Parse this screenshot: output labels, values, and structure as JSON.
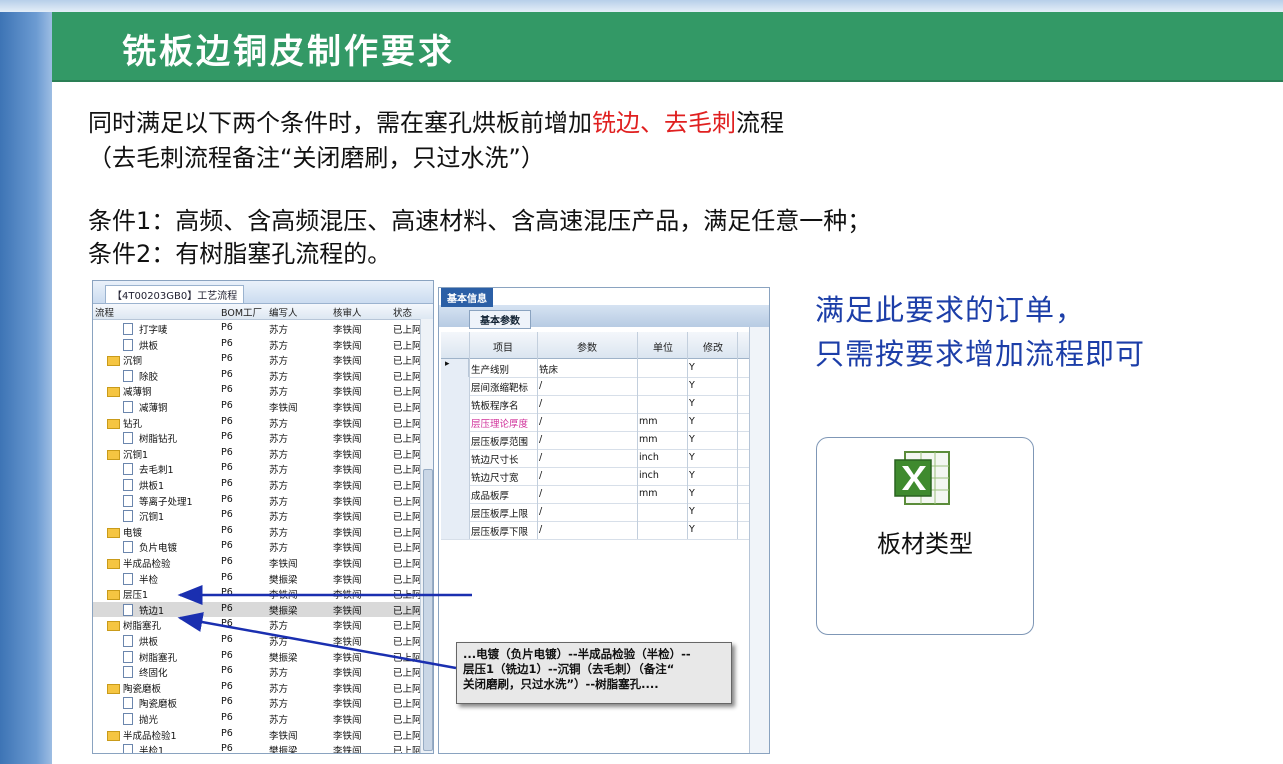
{
  "slide": {
    "title": "铣板边铜皮制作要求",
    "line1_a": "同时满足以下两个条件时，需在塞孔烘板前增加",
    "line1_red": "铣边、去毛刺",
    "line1_b": "流程",
    "line2": "（去毛刺流程备注“关闭磨刷，只过水洗”）",
    "cond1": "条件1：高频、含高频混压、高速材料、含高速混压产品，满足任意一种；",
    "cond2": "条件2：有树脂塞孔流程的。",
    "note_line1": "满足此要求的订单，",
    "note_line2": "只需按要求增加流程即可",
    "excel_label": "板材类型",
    "accent_color": "#339966",
    "note_color": "#1c3ea8"
  },
  "tree_panel": {
    "tab": "【4T00203GB0】工艺流程",
    "headers": [
      "流程",
      "BOM工厂",
      "编写人",
      "核审人",
      "状态"
    ],
    "rows": [
      {
        "name": "打字唛",
        "type": "doc",
        "level": 2,
        "bom": "P6",
        "writer": "苏方",
        "reviewer": "李铁闯",
        "status": "已上阿"
      },
      {
        "name": "烘板",
        "type": "doc",
        "level": 2,
        "bom": "P6",
        "writer": "苏方",
        "reviewer": "李铁闯",
        "status": "已上阿"
      },
      {
        "name": "沉铜",
        "type": "folder",
        "level": 1,
        "bom": "P6",
        "writer": "苏方",
        "reviewer": "李铁闯",
        "status": "已上阿"
      },
      {
        "name": "除胶",
        "type": "doc",
        "level": 2,
        "bom": "P6",
        "writer": "苏方",
        "reviewer": "李铁闯",
        "status": "已上阿"
      },
      {
        "name": "减薄铜",
        "type": "folder",
        "level": 1,
        "bom": "P6",
        "writer": "苏方",
        "reviewer": "李铁闯",
        "status": "已上阿"
      },
      {
        "name": "减薄铜",
        "type": "doc",
        "level": 2,
        "bom": "P6",
        "writer": "李铁闯",
        "reviewer": "李铁闯",
        "status": "已上阿"
      },
      {
        "name": "钻孔",
        "type": "folder",
        "level": 1,
        "bom": "P6",
        "writer": "苏方",
        "reviewer": "李铁闯",
        "status": "已上阿"
      },
      {
        "name": "树脂钻孔",
        "type": "doc",
        "level": 2,
        "bom": "P6",
        "writer": "苏方",
        "reviewer": "李铁闯",
        "status": "已上阿"
      },
      {
        "name": "沉铜1",
        "type": "folder",
        "level": 1,
        "bom": "P6",
        "writer": "苏方",
        "reviewer": "李铁闯",
        "status": "已上阿"
      },
      {
        "name": "去毛刺1",
        "type": "doc",
        "level": 2,
        "bom": "P6",
        "writer": "苏方",
        "reviewer": "李铁闯",
        "status": "已上阿"
      },
      {
        "name": "烘板1",
        "type": "doc",
        "level": 2,
        "bom": "P6",
        "writer": "苏方",
        "reviewer": "李铁闯",
        "status": "已上阿"
      },
      {
        "name": "等离子处理1",
        "type": "doc",
        "level": 2,
        "bom": "P6",
        "writer": "苏方",
        "reviewer": "李铁闯",
        "status": "已上阿"
      },
      {
        "name": "沉铜1",
        "type": "doc",
        "level": 2,
        "bom": "P6",
        "writer": "苏方",
        "reviewer": "李铁闯",
        "status": "已上阿"
      },
      {
        "name": "电镀",
        "type": "folder",
        "level": 1,
        "bom": "P6",
        "writer": "苏方",
        "reviewer": "李铁闯",
        "status": "已上阿"
      },
      {
        "name": "负片电镀",
        "type": "doc",
        "level": 2,
        "bom": "P6",
        "writer": "苏方",
        "reviewer": "李铁闯",
        "status": "已上阿"
      },
      {
        "name": "半成品检验",
        "type": "folder",
        "level": 1,
        "bom": "P6",
        "writer": "李铁闯",
        "reviewer": "李铁闯",
        "status": "已上阿"
      },
      {
        "name": "半检",
        "type": "doc",
        "level": 2,
        "bom": "P6",
        "writer": "樊振梁",
        "reviewer": "李铁闯",
        "status": "已上阿"
      },
      {
        "name": "层压1",
        "type": "folder",
        "level": 1,
        "bom": "P6",
        "writer": "李铁闯",
        "reviewer": "李铁闯",
        "status": "已上阿"
      },
      {
        "name": "铣边1",
        "type": "doc",
        "level": 2,
        "bom": "P6",
        "writer": "樊振梁",
        "reviewer": "李铁闯",
        "status": "已上阿",
        "highlight": true
      },
      {
        "name": "树脂塞孔",
        "type": "folder",
        "level": 1,
        "bom": "P6",
        "writer": "苏方",
        "reviewer": "李铁闯",
        "status": "已上阿"
      },
      {
        "name": "烘板",
        "type": "doc",
        "level": 2,
        "bom": "P6",
        "writer": "苏方",
        "reviewer": "李铁闯",
        "status": "已上阿"
      },
      {
        "name": "树脂塞孔",
        "type": "doc",
        "level": 2,
        "bom": "P6",
        "writer": "樊振梁",
        "reviewer": "李铁闯",
        "status": "已上阿"
      },
      {
        "name": "终固化",
        "type": "doc",
        "level": 2,
        "bom": "P6",
        "writer": "苏方",
        "reviewer": "李铁闯",
        "status": "已上阿"
      },
      {
        "name": "陶瓷磨板",
        "type": "folder",
        "level": 1,
        "bom": "P6",
        "writer": "苏方",
        "reviewer": "李铁闯",
        "status": "已上阿"
      },
      {
        "name": "陶瓷磨板",
        "type": "doc",
        "level": 2,
        "bom": "P6",
        "writer": "苏方",
        "reviewer": "李铁闯",
        "status": "已上阿"
      },
      {
        "name": "抛光",
        "type": "doc",
        "level": 2,
        "bom": "P6",
        "writer": "苏方",
        "reviewer": "李铁闯",
        "status": "已上阿"
      },
      {
        "name": "半成品检验1",
        "type": "folder",
        "level": 1,
        "bom": "P6",
        "writer": "李铁闯",
        "reviewer": "李铁闯",
        "status": "已上阿"
      },
      {
        "name": "半检1",
        "type": "doc",
        "level": 2,
        "bom": "P6",
        "writer": "樊振梁",
        "reviewer": "李铁闯",
        "status": "已上阿"
      }
    ]
  },
  "param_panel": {
    "tab_top": "基本信息",
    "tab_sub": "基本参数",
    "headers": [
      "项目",
      "参数",
      "单位",
      "修改"
    ],
    "rows": [
      {
        "item": "生产线别",
        "param": "铣床",
        "unit": "",
        "edit": "Y",
        "current": true
      },
      {
        "item": "层间涨缩靶标",
        "param": "/",
        "unit": "",
        "edit": "Y"
      },
      {
        "item": "铣板程序名",
        "param": "/",
        "unit": "",
        "edit": "Y"
      },
      {
        "item": "层压理论厚度",
        "param": "/",
        "unit": "mm",
        "edit": "Y",
        "pink": true
      },
      {
        "item": "层压板厚范围",
        "param": "/",
        "unit": "mm",
        "edit": "Y"
      },
      {
        "item": "铣边尺寸长",
        "param": "/",
        "unit": "inch",
        "edit": "Y"
      },
      {
        "item": "铣边尺寸宽",
        "param": "/",
        "unit": "inch",
        "edit": "Y"
      },
      {
        "item": "成品板厚",
        "param": "/",
        "unit": "mm",
        "edit": "Y"
      },
      {
        "item": "层压板厚上限",
        "param": "/",
        "unit": "",
        "edit": "Y"
      },
      {
        "item": "层压板厚下限",
        "param": "/",
        "unit": "",
        "edit": "Y"
      }
    ]
  },
  "callout": {
    "line1": "...电镀（负片电镀）--半成品检验（半检）--",
    "line2": "层压1（铣边1）--沉铜（去毛刺）（备注“",
    "line3": "关闭磨刷，只过水洗”）--树脂塞孔...."
  }
}
